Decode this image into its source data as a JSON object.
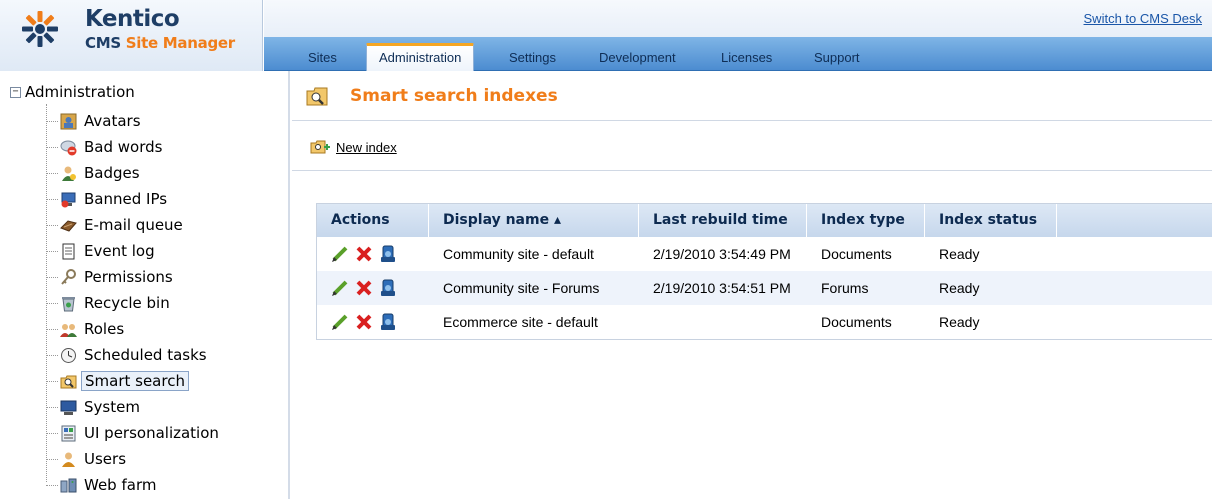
{
  "app": {
    "logo_name": "Kentico",
    "logo_subtitle_plain": "CMS",
    "logo_subtitle_accent": "Site Manager",
    "switch_link": "Switch to CMS Desk"
  },
  "tabs": [
    {
      "label": "Sites",
      "active": false
    },
    {
      "label": "Administration",
      "active": true
    },
    {
      "label": "Settings",
      "active": false
    },
    {
      "label": "Development",
      "active": false
    },
    {
      "label": "Licenses",
      "active": false
    },
    {
      "label": "Support",
      "active": false
    }
  ],
  "tree": {
    "root_label": "Administration",
    "expander": "−",
    "items": [
      {
        "label": "Avatars",
        "icon": "avatar-icon"
      },
      {
        "label": "Bad words",
        "icon": "bad-words-icon"
      },
      {
        "label": "Badges",
        "icon": "badge-icon"
      },
      {
        "label": "Banned IPs",
        "icon": "banned-ip-icon"
      },
      {
        "label": "E-mail queue",
        "icon": "email-queue-icon"
      },
      {
        "label": "Event log",
        "icon": "event-log-icon"
      },
      {
        "label": "Permissions",
        "icon": "permissions-icon"
      },
      {
        "label": "Recycle bin",
        "icon": "recycle-bin-icon"
      },
      {
        "label": "Roles",
        "icon": "roles-icon"
      },
      {
        "label": "Scheduled tasks",
        "icon": "clock-icon"
      },
      {
        "label": "Smart search",
        "icon": "smart-search-icon",
        "selected": true
      },
      {
        "label": "System",
        "icon": "system-icon"
      },
      {
        "label": "UI personalization",
        "icon": "ui-personalization-icon"
      },
      {
        "label": "Users",
        "icon": "users-icon"
      },
      {
        "label": "Web farm",
        "icon": "web-farm-icon"
      }
    ]
  },
  "main": {
    "title": "Smart search indexes",
    "new_index_label": "New index",
    "columns": [
      "Actions",
      "Display name ▴",
      "Last rebuild time",
      "Index type",
      "Index status"
    ],
    "rows": [
      {
        "name": "Community site - default",
        "time": "2/19/2010 3:54:49 PM",
        "type": "Documents",
        "status": "Ready"
      },
      {
        "name": "Community site - Forums",
        "time": "2/19/2010 3:54:51 PM",
        "type": "Forums",
        "status": "Ready"
      },
      {
        "name": "Ecommerce site - default",
        "time": "",
        "type": "Documents",
        "status": "Ready"
      }
    ]
  },
  "colors": {
    "title_orange": "#f07d1a",
    "tab_blue": "#4c8cd0",
    "link_blue": "#1a56a8",
    "row_alt": "#eef3fb"
  }
}
